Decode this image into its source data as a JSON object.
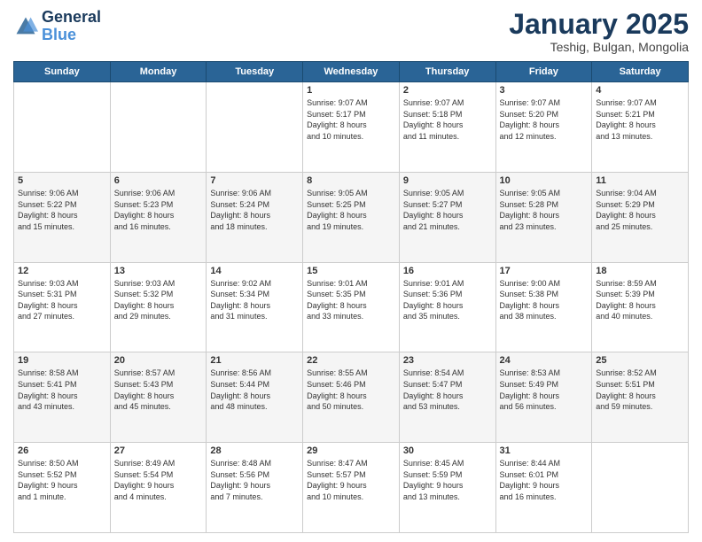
{
  "logo": {
    "line1": "General",
    "line2": "Blue"
  },
  "header": {
    "month": "January 2025",
    "location": "Teshig, Bulgan, Mongolia"
  },
  "weekdays": [
    "Sunday",
    "Monday",
    "Tuesday",
    "Wednesday",
    "Thursday",
    "Friday",
    "Saturday"
  ],
  "weeks": [
    [
      {
        "day": "",
        "detail": ""
      },
      {
        "day": "",
        "detail": ""
      },
      {
        "day": "",
        "detail": ""
      },
      {
        "day": "1",
        "detail": "Sunrise: 9:07 AM\nSunset: 5:17 PM\nDaylight: 8 hours\nand 10 minutes."
      },
      {
        "day": "2",
        "detail": "Sunrise: 9:07 AM\nSunset: 5:18 PM\nDaylight: 8 hours\nand 11 minutes."
      },
      {
        "day": "3",
        "detail": "Sunrise: 9:07 AM\nSunset: 5:20 PM\nDaylight: 8 hours\nand 12 minutes."
      },
      {
        "day": "4",
        "detail": "Sunrise: 9:07 AM\nSunset: 5:21 PM\nDaylight: 8 hours\nand 13 minutes."
      }
    ],
    [
      {
        "day": "5",
        "detail": "Sunrise: 9:06 AM\nSunset: 5:22 PM\nDaylight: 8 hours\nand 15 minutes."
      },
      {
        "day": "6",
        "detail": "Sunrise: 9:06 AM\nSunset: 5:23 PM\nDaylight: 8 hours\nand 16 minutes."
      },
      {
        "day": "7",
        "detail": "Sunrise: 9:06 AM\nSunset: 5:24 PM\nDaylight: 8 hours\nand 18 minutes."
      },
      {
        "day": "8",
        "detail": "Sunrise: 9:05 AM\nSunset: 5:25 PM\nDaylight: 8 hours\nand 19 minutes."
      },
      {
        "day": "9",
        "detail": "Sunrise: 9:05 AM\nSunset: 5:27 PM\nDaylight: 8 hours\nand 21 minutes."
      },
      {
        "day": "10",
        "detail": "Sunrise: 9:05 AM\nSunset: 5:28 PM\nDaylight: 8 hours\nand 23 minutes."
      },
      {
        "day": "11",
        "detail": "Sunrise: 9:04 AM\nSunset: 5:29 PM\nDaylight: 8 hours\nand 25 minutes."
      }
    ],
    [
      {
        "day": "12",
        "detail": "Sunrise: 9:03 AM\nSunset: 5:31 PM\nDaylight: 8 hours\nand 27 minutes."
      },
      {
        "day": "13",
        "detail": "Sunrise: 9:03 AM\nSunset: 5:32 PM\nDaylight: 8 hours\nand 29 minutes."
      },
      {
        "day": "14",
        "detail": "Sunrise: 9:02 AM\nSunset: 5:34 PM\nDaylight: 8 hours\nand 31 minutes."
      },
      {
        "day": "15",
        "detail": "Sunrise: 9:01 AM\nSunset: 5:35 PM\nDaylight: 8 hours\nand 33 minutes."
      },
      {
        "day": "16",
        "detail": "Sunrise: 9:01 AM\nSunset: 5:36 PM\nDaylight: 8 hours\nand 35 minutes."
      },
      {
        "day": "17",
        "detail": "Sunrise: 9:00 AM\nSunset: 5:38 PM\nDaylight: 8 hours\nand 38 minutes."
      },
      {
        "day": "18",
        "detail": "Sunrise: 8:59 AM\nSunset: 5:39 PM\nDaylight: 8 hours\nand 40 minutes."
      }
    ],
    [
      {
        "day": "19",
        "detail": "Sunrise: 8:58 AM\nSunset: 5:41 PM\nDaylight: 8 hours\nand 43 minutes."
      },
      {
        "day": "20",
        "detail": "Sunrise: 8:57 AM\nSunset: 5:43 PM\nDaylight: 8 hours\nand 45 minutes."
      },
      {
        "day": "21",
        "detail": "Sunrise: 8:56 AM\nSunset: 5:44 PM\nDaylight: 8 hours\nand 48 minutes."
      },
      {
        "day": "22",
        "detail": "Sunrise: 8:55 AM\nSunset: 5:46 PM\nDaylight: 8 hours\nand 50 minutes."
      },
      {
        "day": "23",
        "detail": "Sunrise: 8:54 AM\nSunset: 5:47 PM\nDaylight: 8 hours\nand 53 minutes."
      },
      {
        "day": "24",
        "detail": "Sunrise: 8:53 AM\nSunset: 5:49 PM\nDaylight: 8 hours\nand 56 minutes."
      },
      {
        "day": "25",
        "detail": "Sunrise: 8:52 AM\nSunset: 5:51 PM\nDaylight: 8 hours\nand 59 minutes."
      }
    ],
    [
      {
        "day": "26",
        "detail": "Sunrise: 8:50 AM\nSunset: 5:52 PM\nDaylight: 9 hours\nand 1 minute."
      },
      {
        "day": "27",
        "detail": "Sunrise: 8:49 AM\nSunset: 5:54 PM\nDaylight: 9 hours\nand 4 minutes."
      },
      {
        "day": "28",
        "detail": "Sunrise: 8:48 AM\nSunset: 5:56 PM\nDaylight: 9 hours\nand 7 minutes."
      },
      {
        "day": "29",
        "detail": "Sunrise: 8:47 AM\nSunset: 5:57 PM\nDaylight: 9 hours\nand 10 minutes."
      },
      {
        "day": "30",
        "detail": "Sunrise: 8:45 AM\nSunset: 5:59 PM\nDaylight: 9 hours\nand 13 minutes."
      },
      {
        "day": "31",
        "detail": "Sunrise: 8:44 AM\nSunset: 6:01 PM\nDaylight: 9 hours\nand 16 minutes."
      },
      {
        "day": "",
        "detail": ""
      }
    ]
  ]
}
